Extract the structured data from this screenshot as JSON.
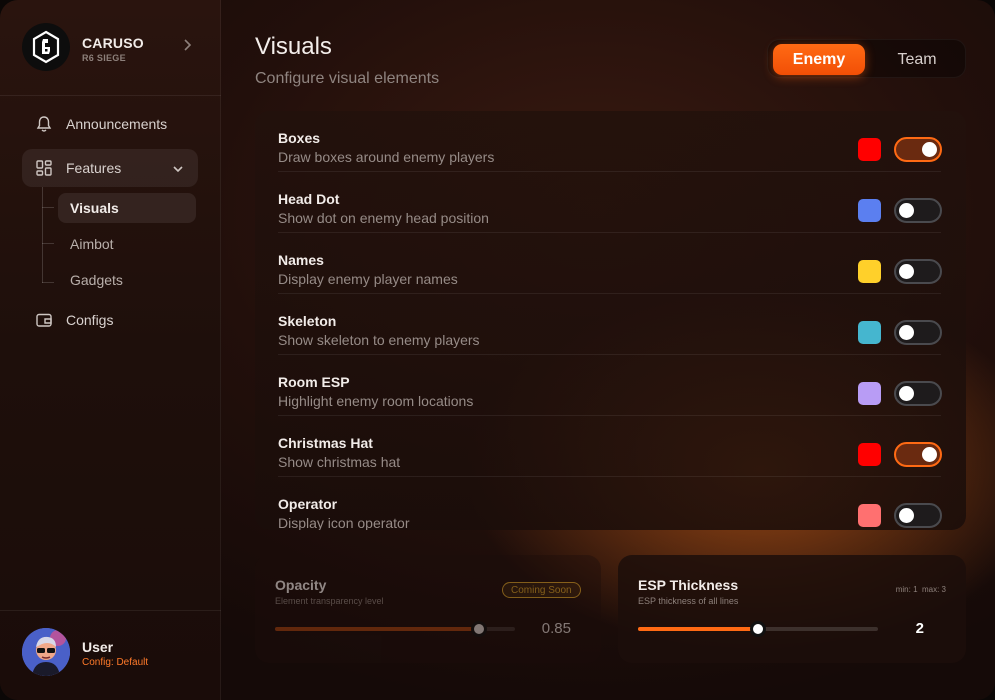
{
  "brand": {
    "name": "CARUSO",
    "subtitle": "R6 SIEGE"
  },
  "nav": {
    "announcements": "Announcements",
    "features": "Features",
    "sub_items": [
      "Visuals",
      "Aimbot",
      "Gadgets"
    ],
    "configs": "Configs"
  },
  "user": {
    "name": "User",
    "config": "Config: Default"
  },
  "header": {
    "title": "Visuals",
    "subtitle": "Configure visual elements"
  },
  "segment": {
    "enemy": "Enemy",
    "team": "Team",
    "selected": "Enemy"
  },
  "features": [
    {
      "title": "Boxes",
      "desc": "Draw boxes around enemy players",
      "color": "#ff0000",
      "enabled": true
    },
    {
      "title": "Head Dot",
      "desc": "Show dot on enemy head position",
      "color": "#5b7ff0",
      "enabled": false
    },
    {
      "title": "Names",
      "desc": "Display enemy player names",
      "color": "#ffd02a",
      "enabled": false
    },
    {
      "title": "Skeleton",
      "desc": "Show skeleton to enemy players",
      "color": "#45b6cf",
      "enabled": false
    },
    {
      "title": "Room ESP",
      "desc": "Highlight enemy room locations",
      "color": "#b89cf5",
      "enabled": false
    },
    {
      "title": "Christmas Hat",
      "desc": "Show christmas hat",
      "color": "#ff0000",
      "enabled": true
    },
    {
      "title": "Operator",
      "desc": "Display icon operator",
      "color": "#ff7070",
      "enabled": false
    }
  ],
  "opacity": {
    "title": "Opacity",
    "desc": "Element transparency level",
    "badge": "Coming Soon",
    "value": "0.85",
    "fraction": 0.85
  },
  "thickness": {
    "title": "ESP Thickness",
    "desc": "ESP thickness of all lines",
    "min_label": "min: 1",
    "max_label": "max: 3",
    "value": "2",
    "min": 1,
    "max": 3
  }
}
